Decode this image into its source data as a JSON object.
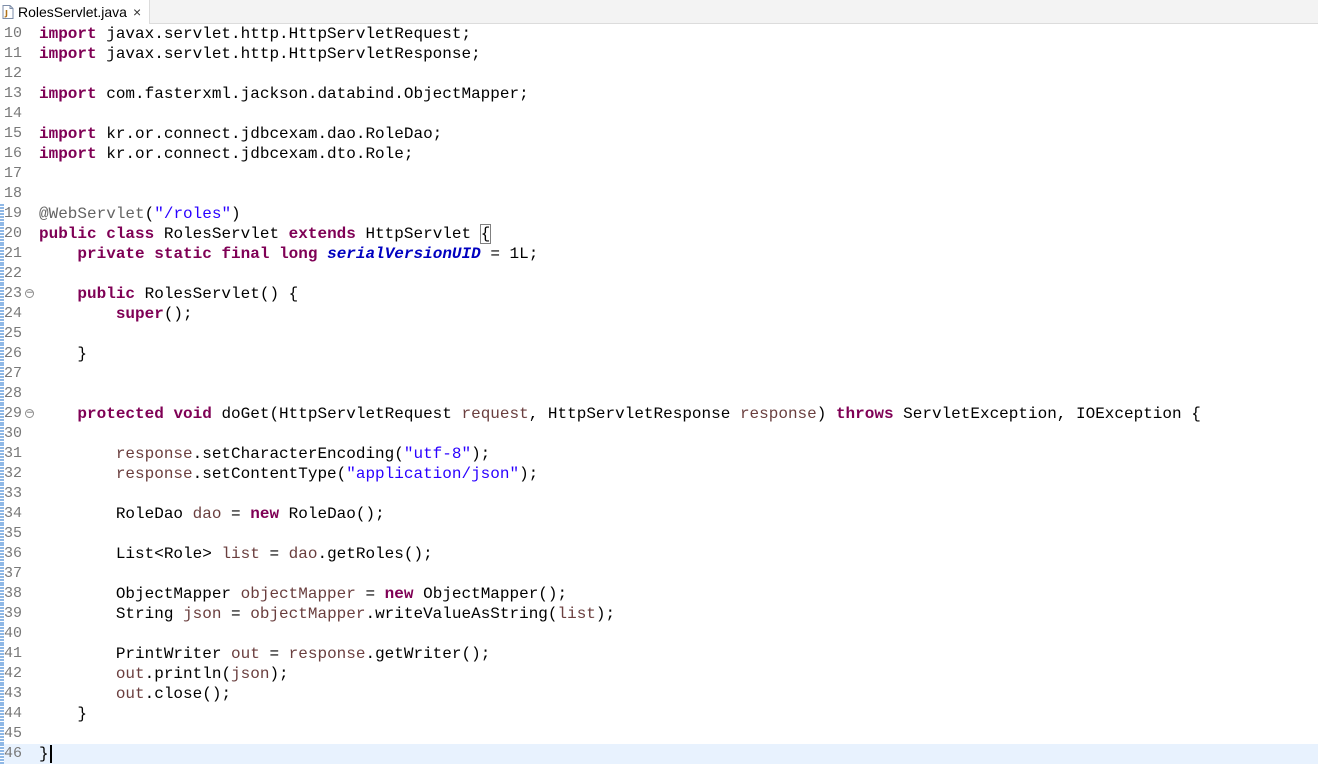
{
  "tab": {
    "label": "RolesServlet.java",
    "close": "×"
  },
  "lines": [
    {
      "n": "10",
      "tokens": [
        {
          "t": "import",
          "c": "kw"
        },
        {
          "t": " javax.servlet.http.HttpServletRequest;"
        }
      ]
    },
    {
      "n": "11",
      "tokens": [
        {
          "t": "import",
          "c": "kw"
        },
        {
          "t": " javax.servlet.http.HttpServletResponse;"
        }
      ]
    },
    {
      "n": "12",
      "tokens": []
    },
    {
      "n": "13",
      "tokens": [
        {
          "t": "import",
          "c": "kw"
        },
        {
          "t": " com.fasterxml.jackson.databind.ObjectMapper;"
        }
      ]
    },
    {
      "n": "14",
      "tokens": []
    },
    {
      "n": "15",
      "tokens": [
        {
          "t": "import",
          "c": "kw"
        },
        {
          "t": " kr.or.connect.jdbcexam.dao.RoleDao;"
        }
      ]
    },
    {
      "n": "16",
      "tokens": [
        {
          "t": "import",
          "c": "kw"
        },
        {
          "t": " kr.or.connect.jdbcexam.dto.Role;"
        }
      ]
    },
    {
      "n": "17",
      "tokens": []
    },
    {
      "n": "18",
      "tokens": []
    },
    {
      "n": "19",
      "bar": true,
      "tokens": [
        {
          "t": "@WebServlet",
          "c": "ann"
        },
        {
          "t": "("
        },
        {
          "t": "\"/roles\"",
          "c": "str"
        },
        {
          "t": ")"
        }
      ]
    },
    {
      "n": "20",
      "bar": true,
      "tokens": [
        {
          "t": "public",
          "c": "kw"
        },
        {
          "t": " "
        },
        {
          "t": "class",
          "c": "kw"
        },
        {
          "t": " RolesServlet "
        },
        {
          "t": "extends",
          "c": "kw"
        },
        {
          "t": " HttpServlet "
        },
        {
          "t": "{",
          "c": "brace-box"
        }
      ]
    },
    {
      "n": "21",
      "bar": true,
      "tokens": [
        {
          "t": "    "
        },
        {
          "t": "private",
          "c": "kw"
        },
        {
          "t": " "
        },
        {
          "t": "static",
          "c": "kw"
        },
        {
          "t": " "
        },
        {
          "t": "final",
          "c": "kw"
        },
        {
          "t": " "
        },
        {
          "t": "long",
          "c": "kw"
        },
        {
          "t": " "
        },
        {
          "t": "serialVersionUID",
          "c": "fld"
        },
        {
          "t": " = 1L;"
        }
      ]
    },
    {
      "n": "22",
      "bar": true,
      "tokens": []
    },
    {
      "n": "23",
      "bar": true,
      "fold": true,
      "tokens": [
        {
          "t": "    "
        },
        {
          "t": "public",
          "c": "kw"
        },
        {
          "t": " RolesServlet() {"
        }
      ]
    },
    {
      "n": "24",
      "bar": true,
      "tokens": [
        {
          "t": "        "
        },
        {
          "t": "super",
          "c": "kw"
        },
        {
          "t": "();"
        }
      ]
    },
    {
      "n": "25",
      "bar": true,
      "tokens": []
    },
    {
      "n": "26",
      "bar": true,
      "tokens": [
        {
          "t": "    }"
        }
      ]
    },
    {
      "n": "27",
      "bar": true,
      "tokens": []
    },
    {
      "n": "28",
      "bar": true,
      "tokens": []
    },
    {
      "n": "29",
      "bar": true,
      "fold": true,
      "tokens": [
        {
          "t": "    "
        },
        {
          "t": "protected",
          "c": "kw"
        },
        {
          "t": " "
        },
        {
          "t": "void",
          "c": "kw"
        },
        {
          "t": " doGet(HttpServletRequest "
        },
        {
          "t": "request",
          "c": "var"
        },
        {
          "t": ", HttpServletResponse "
        },
        {
          "t": "response",
          "c": "var"
        },
        {
          "t": ") "
        },
        {
          "t": "throws",
          "c": "kw"
        },
        {
          "t": " ServletException, IOException {"
        }
      ]
    },
    {
      "n": "30",
      "bar": true,
      "tokens": []
    },
    {
      "n": "31",
      "bar": true,
      "tokens": [
        {
          "t": "        "
        },
        {
          "t": "response",
          "c": "var"
        },
        {
          "t": ".setCharacterEncoding("
        },
        {
          "t": "\"utf-8\"",
          "c": "str"
        },
        {
          "t": ");"
        }
      ]
    },
    {
      "n": "32",
      "bar": true,
      "tokens": [
        {
          "t": "        "
        },
        {
          "t": "response",
          "c": "var"
        },
        {
          "t": ".setContentType("
        },
        {
          "t": "\"application/json\"",
          "c": "str"
        },
        {
          "t": ");"
        }
      ]
    },
    {
      "n": "33",
      "bar": true,
      "tokens": []
    },
    {
      "n": "34",
      "bar": true,
      "tokens": [
        {
          "t": "        RoleDao "
        },
        {
          "t": "dao",
          "c": "var"
        },
        {
          "t": " = "
        },
        {
          "t": "new",
          "c": "kw"
        },
        {
          "t": " RoleDao();"
        }
      ]
    },
    {
      "n": "35",
      "bar": true,
      "tokens": []
    },
    {
      "n": "36",
      "bar": true,
      "tokens": [
        {
          "t": "        List<Role> "
        },
        {
          "t": "list",
          "c": "var"
        },
        {
          "t": " = "
        },
        {
          "t": "dao",
          "c": "var"
        },
        {
          "t": ".getRoles();"
        }
      ]
    },
    {
      "n": "37",
      "bar": true,
      "tokens": []
    },
    {
      "n": "38",
      "bar": true,
      "tokens": [
        {
          "t": "        ObjectMapper "
        },
        {
          "t": "objectMapper",
          "c": "var"
        },
        {
          "t": " = "
        },
        {
          "t": "new",
          "c": "kw"
        },
        {
          "t": " ObjectMapper();"
        }
      ]
    },
    {
      "n": "39",
      "bar": true,
      "tokens": [
        {
          "t": "        String "
        },
        {
          "t": "json",
          "c": "var"
        },
        {
          "t": " = "
        },
        {
          "t": "objectMapper",
          "c": "var"
        },
        {
          "t": ".writeValueAsString("
        },
        {
          "t": "list",
          "c": "var"
        },
        {
          "t": ");"
        }
      ]
    },
    {
      "n": "40",
      "bar": true,
      "tokens": []
    },
    {
      "n": "41",
      "bar": true,
      "tokens": [
        {
          "t": "        PrintWriter "
        },
        {
          "t": "out",
          "c": "var"
        },
        {
          "t": " = "
        },
        {
          "t": "response",
          "c": "var"
        },
        {
          "t": ".getWriter();"
        }
      ]
    },
    {
      "n": "42",
      "bar": true,
      "tokens": [
        {
          "t": "        "
        },
        {
          "t": "out",
          "c": "var"
        },
        {
          "t": ".println("
        },
        {
          "t": "json",
          "c": "var"
        },
        {
          "t": ");"
        }
      ]
    },
    {
      "n": "43",
      "bar": true,
      "tokens": [
        {
          "t": "        "
        },
        {
          "t": "out",
          "c": "var"
        },
        {
          "t": ".close();"
        }
      ]
    },
    {
      "n": "44",
      "bar": true,
      "tokens": [
        {
          "t": "    }"
        }
      ]
    },
    {
      "n": "45",
      "bar": true,
      "tokens": []
    },
    {
      "n": "46",
      "bar": true,
      "current": true,
      "caret": true,
      "tokens": [
        {
          "t": "}"
        }
      ]
    }
  ]
}
